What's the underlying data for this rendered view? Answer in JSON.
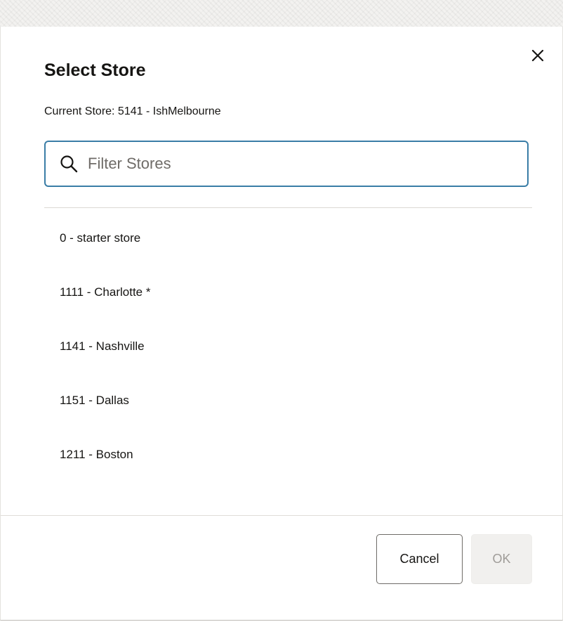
{
  "dialog": {
    "title": "Select Store",
    "current_store": "Current Store: 5141 - IshMelbourne",
    "close_icon": "close-icon"
  },
  "search": {
    "placeholder": "Filter Stores",
    "value": "",
    "icon": "search-icon",
    "border_color": "#3a7da6"
  },
  "stores": [
    {
      "label": "0 - starter store"
    },
    {
      "label": "1111 - Charlotte *"
    },
    {
      "label": "1141 - Nashville"
    },
    {
      "label": "1151 - Dallas"
    },
    {
      "label": "1211 - Boston"
    }
  ],
  "footer": {
    "cancel_label": "Cancel",
    "ok_label": "OK"
  }
}
